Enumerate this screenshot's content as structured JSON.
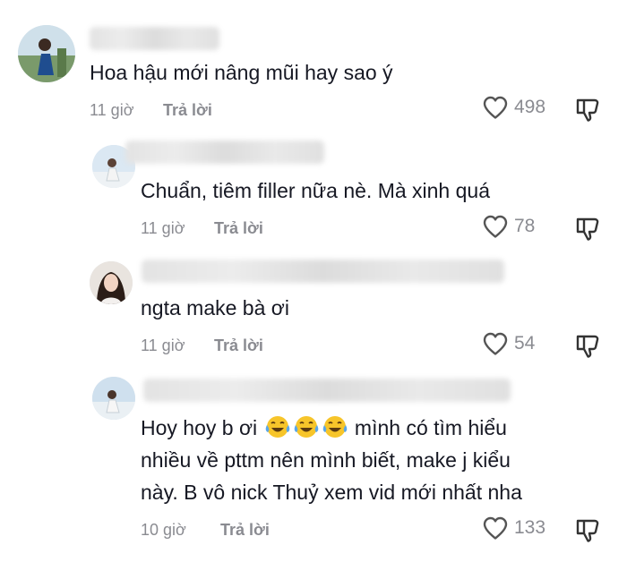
{
  "comments": [
    {
      "text": "Hoa hậu mới nâng mũi hay sao ý",
      "time": "11 giờ",
      "reply_label": "Trả lời",
      "likes": "498"
    },
    {
      "text": "Chuẩn, tiêm filler nữa nè. Mà xinh quá",
      "time": "11 giờ",
      "reply_label": "Trả lời",
      "likes": "78"
    },
    {
      "text": "ngta make bà ơi",
      "time": "11 giờ",
      "reply_label": "Trả lời",
      "likes": "54"
    },
    {
      "text_part1": "Hoy hoy b ơi",
      "text_part2": "mình có tìm hiểu",
      "text_line2": "nhiều về pttm nên mình biết, make j kiểu",
      "text_line3": "này. B vô nick Thuỷ xem vid mới nhất nha",
      "time": "10 giờ",
      "reply_label": "Trả lời",
      "likes": "133"
    }
  ],
  "icons": {
    "like": "heart-outline-icon",
    "dislike": "thumbs-down-outline-icon",
    "emoji": "tears-of-joy-emoji"
  },
  "colors": {
    "text": "#161823",
    "meta": "#8a8b91",
    "emoji_face": "#f7c52a"
  }
}
